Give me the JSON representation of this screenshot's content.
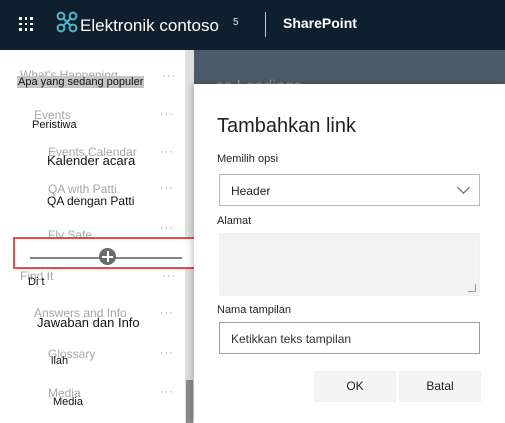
{
  "suite_bar": {
    "app_launcher_icon": "waffle-icon",
    "brand_icon": "sharepoint-logo-icon",
    "site_name": "Elektronik contoso",
    "site_name_suffix": "5",
    "app_name": "SharePoint"
  },
  "navigation": {
    "items": [
      {
        "label": "Apa yang sedang populer",
        "ghost": "What's Happening"
      },
      {
        "label": "Peristiwa",
        "ghost": "Events"
      },
      {
        "label": "Kalender acara",
        "ghost": "Events Calendar"
      },
      {
        "label": "QA dengan Patti",
        "ghost": "QA with Patti"
      },
      {
        "label": "",
        "ghost": "Fly Safe"
      },
      {
        "label": "Di t",
        "ghost": "Find It"
      },
      {
        "label": "Jawaban dan Info",
        "ghost": "Answers and Info"
      },
      {
        "label": "ilah",
        "ghost": "Glossary"
      },
      {
        "label": "Media",
        "ghost": "Media"
      }
    ],
    "more_label": "···"
  },
  "page": {
    "title": "...co Landings"
  },
  "panel": {
    "title": "Tambahkan link",
    "option_label": "Memilih opsi",
    "option_value": "Header",
    "address_label": "Alamat",
    "address_value": "",
    "display_name_label": "Nama tampilan",
    "display_name_placeholder": "Ketikkan teks tampilan",
    "ok_label": "OK",
    "cancel_label": "Batal"
  },
  "colors": {
    "suite_bar": "#0e1f2e",
    "highlight_border": "#e04d4d"
  }
}
